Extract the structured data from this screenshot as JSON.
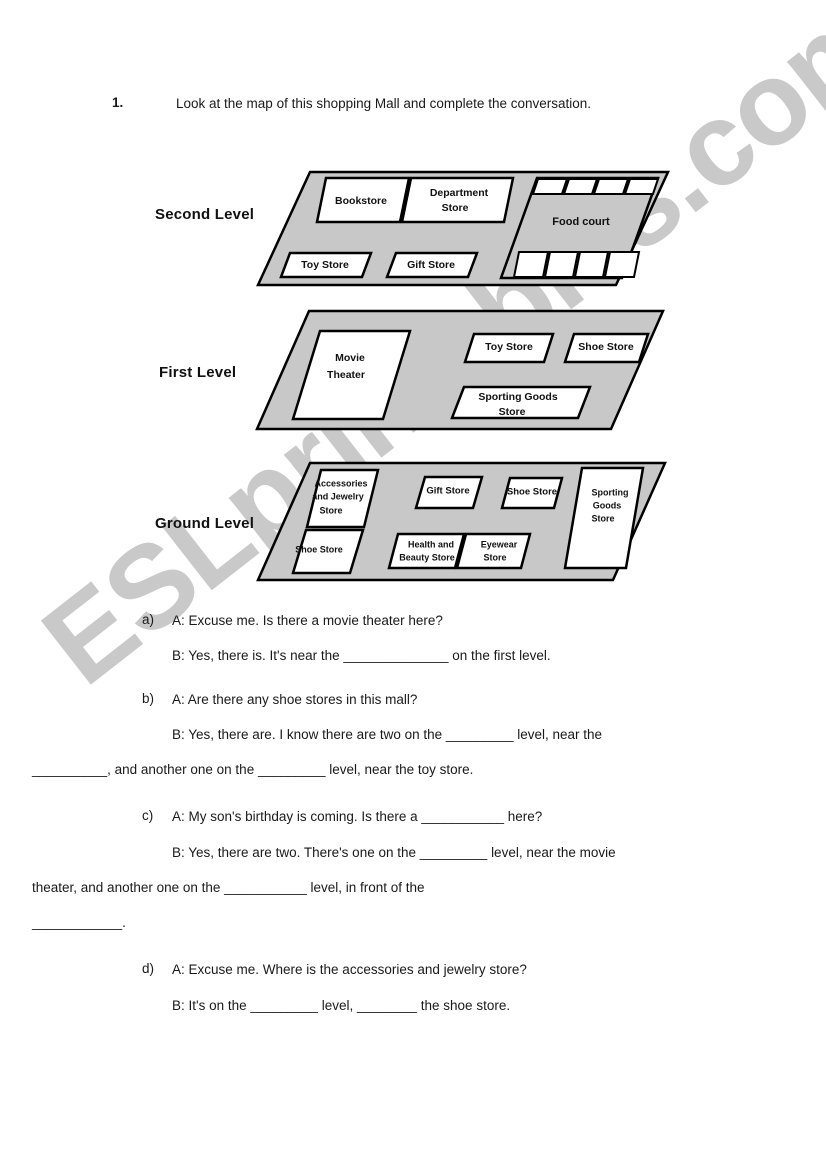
{
  "page": {
    "background_color": "#ffffff",
    "text_color": "#1a1a1a"
  },
  "watermark": {
    "text": "ESLprintables.com",
    "color": "#c9c9c9"
  },
  "instruction": {
    "number": "1.",
    "text": "Look at the map of this shopping Mall and complete the conversation."
  },
  "map": {
    "slab_color": "#c8c8c8",
    "shop_fill": "#ffffff",
    "outline_color": "#000000",
    "levels": [
      {
        "label": "Second Level",
        "shops": [
          "Bookstore",
          "Department Store",
          "Toy Store",
          "Gift Store",
          "Food court"
        ],
        "food_court": {
          "label": "Food court",
          "top_cells": 4,
          "bottom_cells": 4
        }
      },
      {
        "label": "First Level",
        "shops": [
          "Movie Theater",
          "Toy Store",
          "Shoe Store",
          "Sporting Goods Store"
        ]
      },
      {
        "label": "Ground Level",
        "shops": [
          "Accessories and Jewelry Store",
          "Shoe Store",
          "Gift Store",
          "Shoe Store",
          "Health and Beauty Store",
          "Eyewear Store",
          "Sporting Goods Store"
        ]
      }
    ]
  },
  "questions": [
    {
      "marker": "a)",
      "lines": [
        "A: Excuse me. Is there a movie theater here?",
        "B: Yes, there is. It's near the ______________ on the first level."
      ]
    },
    {
      "marker": "b)",
      "lines": [
        "A: Are there any shoe stores in this mall?",
        "B: Yes, there are. I know there are two on the _________ level, near the"
      ],
      "wrap": "__________, and another one on the _________ level, near the toy store."
    },
    {
      "marker": "c)",
      "lines": [
        "A: My son's birthday is coming. Is there a ___________ here?",
        "B: Yes, there are two. There's one on the _________ level, near the movie"
      ],
      "wrap": "theater, and another one on the ___________ level, in front of the",
      "wrap2": "____________."
    },
    {
      "marker": "d)",
      "lines": [
        "A: Excuse me. Where is the accessories and jewelry store?",
        "B: It's on the _________ level, ________ the shoe store."
      ]
    }
  ]
}
